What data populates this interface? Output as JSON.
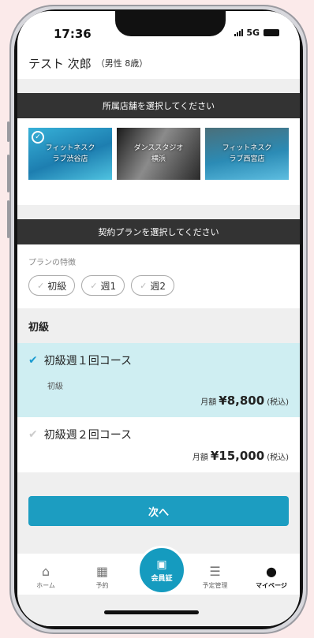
{
  "status_bar": {
    "time": "17:36",
    "network": "5G"
  },
  "user": {
    "name": "テスト 次郎",
    "meta": "（男性 8歳）"
  },
  "store_section": {
    "heading": "所属店舗を選択してください",
    "stores": [
      {
        "name": "フィットネスク\nラブ渋谷店"
      },
      {
        "name": "ダンススタジオ\n横浜"
      },
      {
        "name": "フィットネスク\nラブ西宮店"
      }
    ]
  },
  "plan_section": {
    "heading": "契約プランを選択してください",
    "features_label": "プランの特徴",
    "chips": [
      "初級",
      "週1",
      "週2"
    ]
  },
  "grade_label": "初級",
  "courses": [
    {
      "title": "初級週１回コース",
      "sub": "初級",
      "price_prefix": "月額",
      "price": "¥8,800",
      "tax": "(税込)"
    },
    {
      "title": "初級週２回コース",
      "price_prefix": "月額",
      "price": "¥15,000",
      "tax": "(税込)"
    }
  ],
  "next_button": "次へ",
  "tabbar": {
    "home": "ホーム",
    "reserve": "予約",
    "member": "会員証",
    "schedule": "予定管理",
    "mypage": "マイページ"
  },
  "icons": {
    "home": "house-icon",
    "reserve": "calendar-icon",
    "member": "qr-code-icon",
    "schedule": "list-icon",
    "mypage": "user-circle-icon"
  },
  "colors": {
    "accent": "#1c9dc1",
    "selected_bg": "#cfeef2",
    "header_bg": "#333333"
  }
}
